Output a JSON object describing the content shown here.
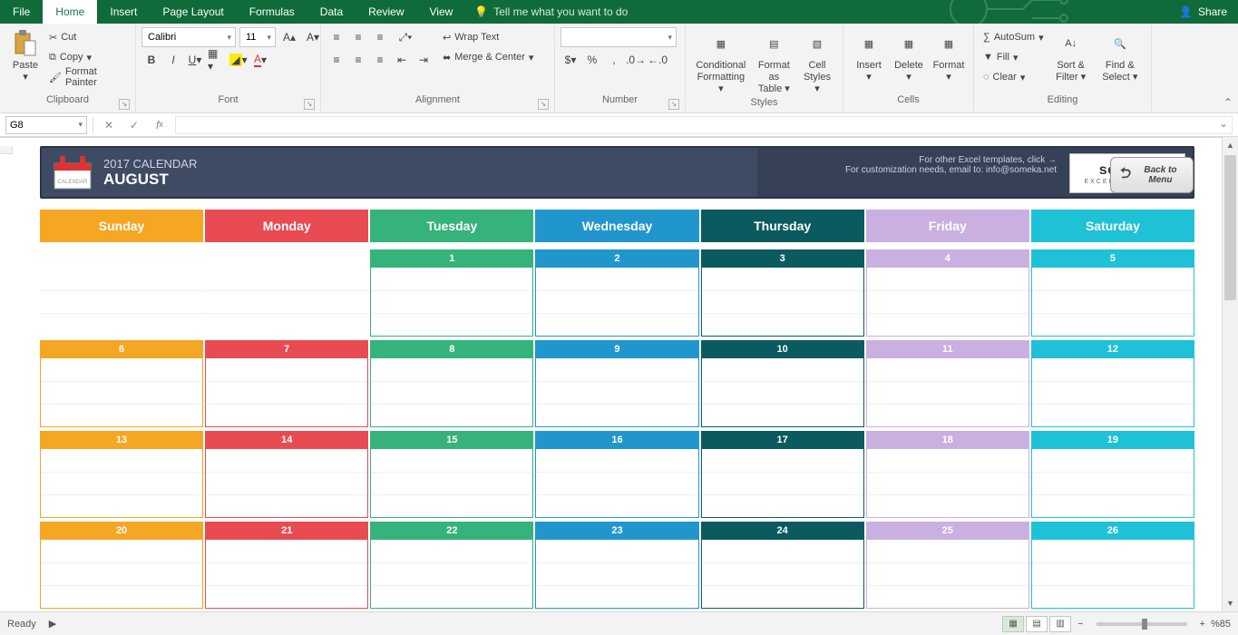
{
  "menu": {
    "tabs": [
      "File",
      "Home",
      "Insert",
      "Page Layout",
      "Formulas",
      "Data",
      "Review",
      "View"
    ],
    "active": 1,
    "tellme": "Tell me what you want to do",
    "share": "Share"
  },
  "ribbon": {
    "clipboard": {
      "label": "Clipboard",
      "paste": "Paste",
      "cut": "Cut",
      "copy": "Copy",
      "fp": "Format Painter"
    },
    "font": {
      "label": "Font",
      "name": "Calibri",
      "size": "11"
    },
    "alignment": {
      "label": "Alignment",
      "wrap": "Wrap Text",
      "merge": "Merge & Center"
    },
    "number": {
      "label": "Number",
      "format": ""
    },
    "styles": {
      "label": "Styles",
      "cond": "Conditional Formatting",
      "ftable": "Format as Table",
      "cstyles": "Cell Styles"
    },
    "cells": {
      "label": "Cells",
      "insert": "Insert",
      "delete": "Delete",
      "format": "Format"
    },
    "editing": {
      "label": "Editing",
      "autosum": "AutoSum",
      "fill": "Fill",
      "clear": "Clear",
      "sort": "Sort & Filter",
      "find": "Find & Select"
    }
  },
  "namebox": "G8",
  "calendar": {
    "title_small": "2017 CALENDAR",
    "title_big": "AUGUST",
    "hint1": "For other Excel templates, click →",
    "hint2": "For customization needs, email to: info@someka.net",
    "logo1": "someka",
    "logo2": "EXCEL SOLUTIONS",
    "back": "Back to Menu",
    "days": [
      "Sunday",
      "Monday",
      "Tuesday",
      "Wednesday",
      "Thursday",
      "Friday",
      "Saturday"
    ],
    "colors": [
      "c-sun",
      "c-mon",
      "c-tue",
      "c-wed",
      "c-thu",
      "c-fri",
      "c-sat"
    ],
    "borders": [
      "b-sun",
      "b-mon",
      "b-tue",
      "b-wed",
      "b-thu",
      "b-fri",
      "b-sat"
    ],
    "weeks": [
      [
        null,
        null,
        "1",
        "2",
        "3",
        "4",
        "5"
      ],
      [
        "6",
        "7",
        "8",
        "9",
        "10",
        "11",
        "12"
      ],
      [
        "13",
        "14",
        "15",
        "16",
        "17",
        "18",
        "19"
      ],
      [
        "20",
        "21",
        "22",
        "23",
        "24",
        "25",
        "26"
      ]
    ]
  },
  "status": {
    "ready": "Ready",
    "zoom": "%85"
  }
}
